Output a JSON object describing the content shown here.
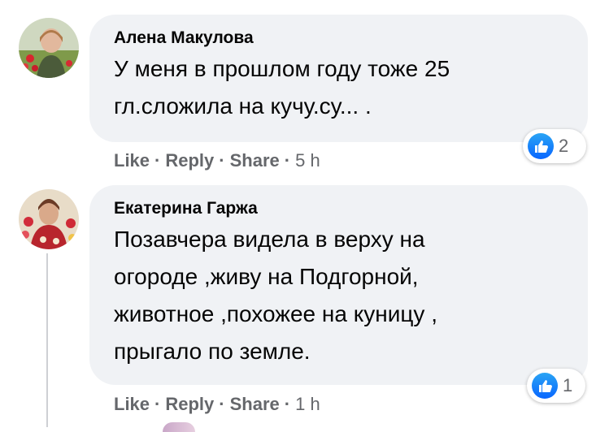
{
  "comments": [
    {
      "author": "Алена Макулова",
      "text": "У меня в прошлом году тоже 25\nгл.сложила на кучу.су... .",
      "reaction_count": "2",
      "actions": {
        "like": "Like",
        "reply": "Reply",
        "share": "Share",
        "time": "5 h"
      }
    },
    {
      "author": "Екатерина Гаржа",
      "text": "Позавчера видела в верху на\nогороде ,живу на Подгорной,\nживотное ,похожее на куницу ,\nпрыгало по земле.",
      "reaction_count": "1",
      "actions": {
        "like": "Like",
        "reply": "Reply",
        "share": "Share",
        "time": "1 h"
      }
    }
  ],
  "separator": "·",
  "colors": {
    "bubble": "#f0f2f5",
    "meta_text": "#65676b",
    "like_blue": "#0866ff",
    "thread_line": "#ced0d4"
  },
  "icons": {
    "reaction": "thumbs-up-icon"
  }
}
